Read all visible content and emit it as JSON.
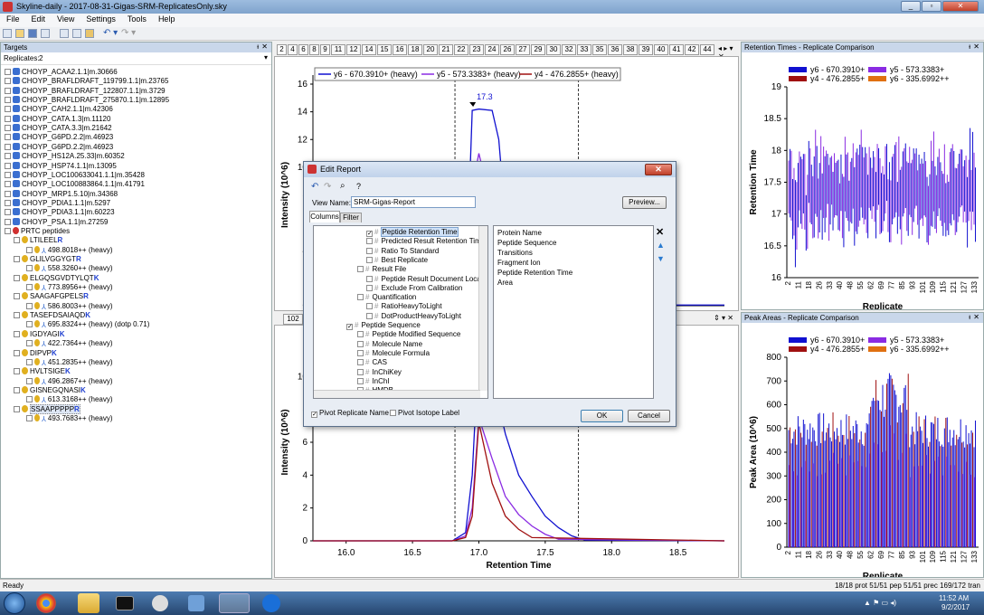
{
  "window": {
    "title": "Skyline-daily - 2017-08-31-Gigas-SRM-ReplicatesOnly.sky"
  },
  "menu": [
    "File",
    "Edit",
    "View",
    "Settings",
    "Tools",
    "Help"
  ],
  "targets": {
    "header": "Targets",
    "replicates_label": "Replicates:",
    "replicates_value": "2",
    "proteins": [
      "CHOYP_ACAA2.1.1|m.30666",
      "CHOYP_BRAFLDRAFT_119799.1.1|m.23765",
      "CHOYP_BRAFLDRAFT_122807.1.1|m.3729",
      "CHOYP_BRAFLDRAFT_275870.1.1|m.12895",
      "CHOYP_CAH2.1.1|m.42306",
      "CHOYP_CATA.1.3|m.11120",
      "CHOYP_CATA.3.3|m.21642",
      "CHOYP_G6PD.2.2|m.46923",
      "CHOYP_G6PD.2.2|m.46923",
      "CHOYP_HS12A.25.33|m.60352",
      "CHOYP_HSP74.1.1|m.13095",
      "CHOYP_LOC100633041.1.1|m.35428",
      "CHOYP_LOC100883864.1.1|m.41791",
      "CHOYP_MRP1.5.10|m.34368",
      "CHOYP_PDIA1.1.1|m.5297",
      "CHOYP_PDIA3.1.1|m.60223",
      "CHOYP_PSA.1.1|m.27259"
    ],
    "group": "PRTC peptides",
    "peptides": [
      {
        "seq": "LTILEEL",
        "last": "R",
        "prec": "498.8018++ (heavy)"
      },
      {
        "seq": "GLILVGGYGT",
        "last": "R",
        "prec": "558.3260++ (heavy)"
      },
      {
        "seq": "ELGQSGVDTYLQT",
        "last": "K",
        "prec": "773.8956++ (heavy)"
      },
      {
        "seq": "SAAGAFGPELS",
        "last": "R",
        "prec": "586.8003++ (heavy)"
      },
      {
        "seq": "TASEFDSAIAQD",
        "last": "K",
        "prec": "695.8324++ (heavy) (dotp 0.71)"
      },
      {
        "seq": "IGDYAGI",
        "last": "K",
        "prec": "422.7364++ (heavy)"
      },
      {
        "seq": "DIPVP",
        "last": "K",
        "prec": "451.2835++ (heavy)"
      },
      {
        "seq": "HVLTSIGE",
        "last": "K",
        "prec": "496.2867++ (heavy)"
      },
      {
        "seq": "GISNEGQNASI",
        "last": "K",
        "prec": "613.3168++ (heavy)"
      },
      {
        "seq": "SSAAPPPPP",
        "last": "R",
        "prec": "493.7683++ (heavy)"
      }
    ]
  },
  "tabs": [
    "2",
    "4",
    "6",
    "8",
    "9",
    "11",
    "12",
    "14",
    "15",
    "16",
    "18",
    "20",
    "21",
    "22",
    "23",
    "24",
    "26",
    "27",
    "29",
    "30",
    "32",
    "33",
    "35",
    "36",
    "38",
    "39",
    "40",
    "41",
    "42",
    "44"
  ],
  "tab_lower": "102",
  "chromatogram": {
    "legend": [
      "y6 - 670.3910+ (heavy)",
      "y5 - 573.3383+ (heavy)",
      "y4 - 476.2855+ (heavy)"
    ],
    "peak_label": "17.3",
    "ylabel": "Intensity (10^6)",
    "xlabel": "Retention Time",
    "colors": {
      "y6": "#1010d0",
      "y5": "#8a2be2",
      "y4": "#a01010"
    }
  },
  "chart_data": [
    {
      "type": "line",
      "title": "",
      "ylabel": "Intensity (10^6)",
      "ylim": [
        0,
        16
      ],
      "yticks": [
        0,
        2,
        4,
        6,
        8,
        10,
        12,
        14,
        16
      ],
      "series": [
        {
          "name": "y6 - 670.3910+ (heavy)",
          "x": [
            16.8,
            16.9,
            16.95,
            17.0,
            17.1,
            17.15,
            17.25,
            17.3,
            17.4
          ],
          "values": [
            0.1,
            0.3,
            14.1,
            14.2,
            14.1,
            12.0,
            0.4,
            0.2,
            0.1
          ]
        },
        {
          "name": "y5 - 573.3383+ (heavy)",
          "x": [
            16.8,
            16.9,
            16.95,
            17.0,
            17.05,
            17.1,
            17.2,
            17.3
          ],
          "values": [
            0.1,
            0.3,
            8.5,
            11.0,
            9.0,
            6.0,
            0.3,
            0.1
          ]
        },
        {
          "name": "y4 - 476.2855+ (heavy)",
          "x": [
            16.8,
            16.9,
            16.95,
            17.0,
            17.05,
            17.1,
            17.2,
            17.3
          ],
          "values": [
            0.1,
            0.2,
            5.0,
            5.8,
            4.8,
            3.0,
            0.2,
            0.1
          ]
        }
      ]
    },
    {
      "type": "line",
      "title": "",
      "xlabel": "Retention Time",
      "ylabel": "Intensity (10^6)",
      "ylim": [
        0,
        12
      ],
      "xlim": [
        15.75,
        18.85
      ],
      "xticks": [
        16.0,
        16.5,
        17.0,
        17.5,
        18.0,
        18.5
      ],
      "yticks": [
        0,
        2,
        4,
        6,
        8,
        10
      ],
      "series": [
        {
          "name": "y6 - 670.3910+ (heavy)",
          "x": [
            15.75,
            16.8,
            16.9,
            16.95,
            17.0,
            17.1,
            17.2,
            17.3,
            17.4,
            17.5,
            17.6,
            17.7,
            17.8,
            18.85
          ],
          "values": [
            0,
            0,
            0.5,
            4,
            12,
            10,
            6.5,
            4,
            2.7,
            1.5,
            0.8,
            0.3,
            0.05,
            0
          ]
        },
        {
          "name": "y5 - 573.3383+ (heavy)",
          "x": [
            15.75,
            16.8,
            16.9,
            16.95,
            17.0,
            17.1,
            17.2,
            17.3,
            17.4,
            17.5,
            17.6,
            18.85
          ],
          "values": [
            0,
            0,
            0.3,
            2,
            7.5,
            5,
            2.7,
            1.6,
            0.9,
            0.4,
            0.1,
            0
          ]
        },
        {
          "name": "y4 - 476.2855+ (heavy)",
          "x": [
            15.75,
            16.8,
            16.9,
            16.95,
            17.0,
            17.1,
            17.2,
            17.3,
            17.4,
            18.85
          ],
          "values": [
            0,
            0,
            0.2,
            1.5,
            7.2,
            3.5,
            1.5,
            0.7,
            0.2,
            0
          ]
        }
      ]
    },
    {
      "type": "bar",
      "title": "Retention Times - Replicate Comparison",
      "xlabel": "Replicate",
      "ylabel": "Retention Time",
      "ylim": [
        16,
        19
      ],
      "yticks": [
        16,
        16.5,
        17,
        17.5,
        18,
        18.5,
        19
      ],
      "xticklabels": [
        "2",
        "11",
        "18",
        "26",
        "33",
        "40",
        "48",
        "55",
        "62",
        "69",
        "77",
        "85",
        "93",
        "101",
        "109",
        "115",
        "121",
        "127",
        "133"
      ],
      "series": [
        {
          "name": "y6 - 670.3910+",
          "color": "#1010d0"
        },
        {
          "name": "y5 - 573.3383+",
          "color": "#8a2be2"
        },
        {
          "name": "y4 - 476.2855+",
          "color": "#a01010"
        },
        {
          "name": "y6 - 335.6992++",
          "color": "#e07010"
        }
      ]
    },
    {
      "type": "bar",
      "title": "Peak Areas - Replicate Comparison",
      "xlabel": "Replicate",
      "ylabel": "Peak Area (10^6)",
      "ylim": [
        0,
        800
      ],
      "yticks": [
        0,
        100,
        200,
        300,
        400,
        500,
        600,
        700,
        800
      ],
      "xticklabels": [
        "2",
        "11",
        "18",
        "26",
        "33",
        "40",
        "48",
        "55",
        "62",
        "69",
        "77",
        "85",
        "93",
        "101",
        "109",
        "115",
        "121",
        "127",
        "133"
      ],
      "series": [
        {
          "name": "y6 - 670.3910+",
          "color": "#1010d0"
        },
        {
          "name": "y5 - 573.3383+",
          "color": "#8a2be2"
        },
        {
          "name": "y4 - 476.2855+",
          "color": "#a01010"
        },
        {
          "name": "y6 - 335.6992++",
          "color": "#e07010"
        }
      ]
    }
  ],
  "dialog": {
    "title": "Edit Report",
    "view_name_label": "View Name:",
    "view_name_value": "SRM-Gigas-Report",
    "preview": "Preview...",
    "tab_columns": "Columns",
    "tab_filter": "Filter",
    "left_items": [
      "Peptide Retention Time",
      "Predicted Result Retention Time",
      "Ratio To Standard",
      "Best Replicate",
      "Result File",
      "Peptide Result Document Location",
      "Exclude From Calibration",
      "Quantification",
      "RatioHeavyToLight",
      "DotProductHeavyToLight",
      "Peptide Sequence",
      "Peptide Modified Sequence",
      "Molecule Name",
      "Molecule Formula",
      "CAS",
      "InChiKey",
      "InChI",
      "HMDB"
    ],
    "right_items": [
      "Protein Name",
      "Peptide Sequence",
      "Transitions",
      "Fragment Ion",
      "Peptide Retention Time",
      "Area"
    ],
    "pivot_replicate": "Pivot Replicate Name",
    "pivot_isotope": "Pivot Isotope Label",
    "ok": "OK",
    "cancel": "Cancel"
  },
  "rt_panel": {
    "title": "Retention Times - Replicate Comparison"
  },
  "pa_panel": {
    "title": "Peak Areas - Replicate Comparison"
  },
  "status": {
    "left": "Ready",
    "right": "18/18 prot   51/51 pep   51/51 prec   169/172 tran"
  },
  "clock": {
    "time": "11:52 AM",
    "date": "9/2/2017"
  }
}
